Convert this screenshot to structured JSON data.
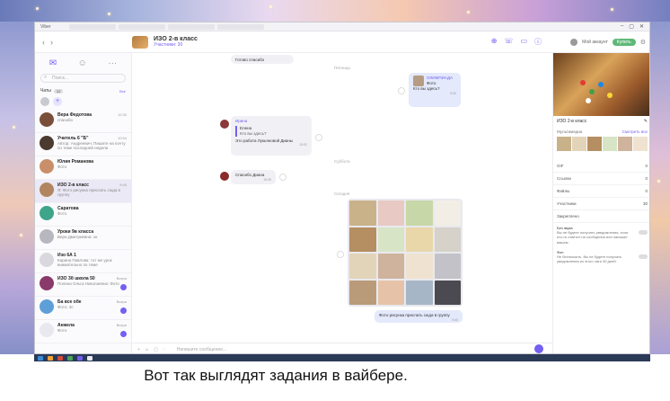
{
  "window": {
    "title": "Viber",
    "controls": [
      "–",
      "▢",
      "✕"
    ]
  },
  "topbar": {
    "chat_title": "ИЗО 2-в класс",
    "chat_subtitle": "Участники: 30",
    "my_name": "Мой аккаунт",
    "purchase_label": "Купить"
  },
  "sidebar": {
    "search_placeholder": "Поиск...",
    "chats_label": "Чаты",
    "chats_count": "12",
    "all_label": "Все",
    "items": [
      {
        "name": "Вера Федотова",
        "msg": "спасибо",
        "time": "12:30",
        "color": "#7a4f3a",
        "badge": false
      },
      {
        "name": "Учитель 6 \"Б\"",
        "msg": "Автор: Андреевич: Пишите на почту по теме последней недели",
        "time": "10:54",
        "color": "#4a3a2f",
        "badge": false
      },
      {
        "name": "Юлия Романова",
        "msg": "Фото",
        "time": "",
        "color": "#c98f6a",
        "badge": false
      },
      {
        "name": "ИЗО 2-в класс",
        "msg": "Я: Фото рисунка прислать сюда в группу",
        "time": "9:40",
        "color": "#b08560",
        "badge": false
      },
      {
        "name": "Саратова",
        "msg": "Фото",
        "time": "",
        "color": "#3fa58a",
        "badge": false
      },
      {
        "name": "Уроки 9в класса",
        "msg": "Вера Дмитриевна: ок",
        "time": "",
        "color": "#b7b7bf",
        "badge": false
      },
      {
        "name": "Изо 6А 1",
        "msg": "Карина Павлова: тот же урок внимательно по теме",
        "time": "",
        "color": "#d8d8de",
        "badge": false
      },
      {
        "name": "ИЗО 3б школа 50",
        "msg": "Полина Ольга Николаевна: Фото",
        "time": "Вчера",
        "color": "#8a3a6a",
        "badge": true
      },
      {
        "name": "Ба все обе",
        "msg": "Фото: 3с",
        "time": "Вчера",
        "color": "#5f9fd8",
        "badge": true
      },
      {
        "name": "Анжела",
        "msg": "Фото",
        "time": "Вчера",
        "color": "#e8e8ee",
        "badge": true
      }
    ]
  },
  "chat": {
    "days": [
      "Пятница",
      "Суббота",
      "Сегодня"
    ],
    "messages": [
      {
        "dir": "in",
        "text": "Готово спасибо",
        "time": ""
      },
      {
        "dir": "out",
        "quote_name": "ОЛИМПИАДА",
        "quote_text": "Фото",
        "text": "Кто вы здесь?",
        "time": "9:32"
      },
      {
        "dir": "in",
        "sender": "Ирина",
        "quote_name": "Елена",
        "quote_text": "Кто вы здесь?",
        "text": "Это работа Лукьяновой Дианы",
        "time": "13:02"
      },
      {
        "dir": "in",
        "text": "Спасибо Диана",
        "time": "15:05"
      },
      {
        "dir": "out",
        "text": "Фото рисунка прислать сюда в группу",
        "time": "9:40"
      }
    ],
    "composer_placeholder": "Напишите сообщение..."
  },
  "info": {
    "title": "ИЗО 2-в класс",
    "media_label": "Мультимедиа",
    "media_link": "Смотреть все",
    "rows": [
      {
        "label": "GIF",
        "value": "0"
      },
      {
        "label": "Ссылки",
        "value": "0"
      },
      {
        "label": "Файлы",
        "value": "0"
      },
      {
        "label": "Участники",
        "value": "30"
      },
      {
        "label": "Закреплено",
        "value": ""
      }
    ],
    "notif_title": "Без звука",
    "notif_text": "Вы не будете получать уведомления, если кто-то ответит на сообщения или напишет вашем",
    "mute_label": "Фон",
    "mute_text": "Не беспокоить. Вы не будете получать уведомления из этого чата 30 дней."
  },
  "caption": "Вот так выглядят задания в вайбере."
}
